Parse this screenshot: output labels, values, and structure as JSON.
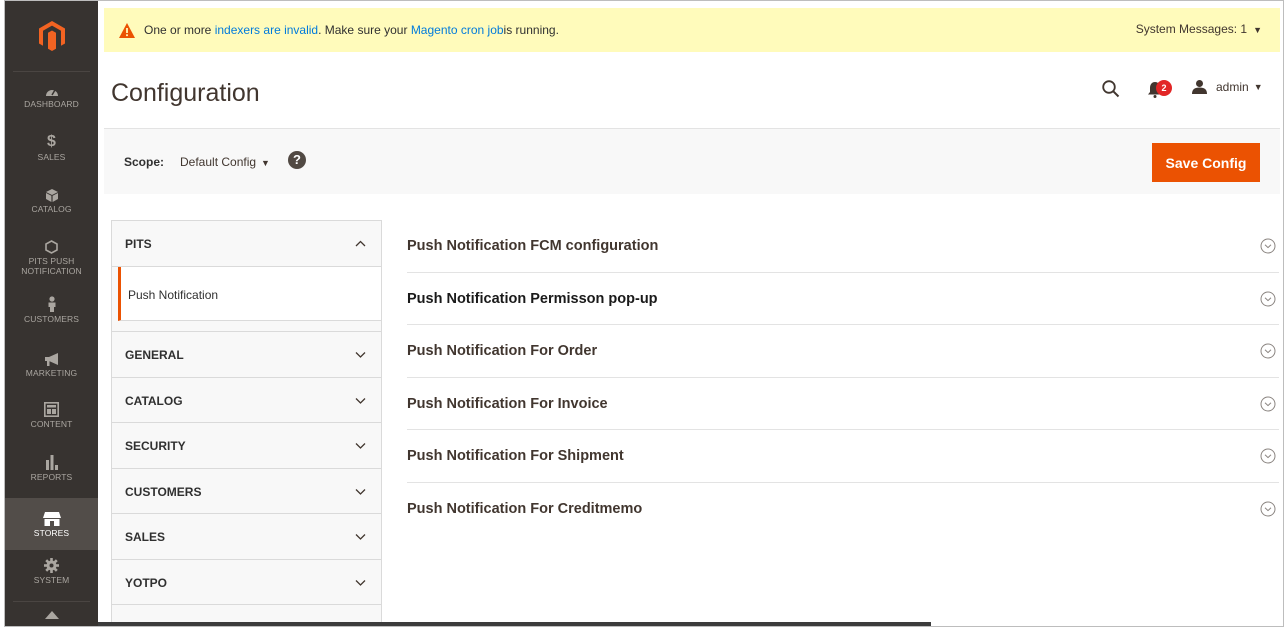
{
  "colors": {
    "sidebar_bg": "#373330",
    "accent": "#eb5202",
    "link": "#007bdb",
    "message_bg": "#fffbbb"
  },
  "sidebar": {
    "items": [
      {
        "label": "DASHBOARD",
        "icon": "dashboard-icon"
      },
      {
        "label": "SALES",
        "icon": "dollar-icon"
      },
      {
        "label": "CATALOG",
        "icon": "box-icon"
      },
      {
        "label": "PITS PUSH NOTIFICATION",
        "label_line1": "PITS PUSH",
        "label_line2": "NOTIFICATION",
        "icon": "hexagon-icon"
      },
      {
        "label": "CUSTOMERS",
        "icon": "person-icon"
      },
      {
        "label": "MARKETING",
        "icon": "megaphone-icon"
      },
      {
        "label": "CONTENT",
        "icon": "content-icon"
      },
      {
        "label": "REPORTS",
        "icon": "bar-chart-icon"
      },
      {
        "label": "STORES",
        "icon": "store-icon",
        "active": true
      },
      {
        "label": "SYSTEM",
        "icon": "gear-icon"
      }
    ]
  },
  "message_bar": {
    "prefix": "One or more ",
    "link1": "indexers are invalid",
    "middle": ". Make sure your ",
    "link2": "Magento cron job",
    "suffix": " is running.",
    "system_messages": "System Messages: 1"
  },
  "header": {
    "title": "Configuration",
    "notification_count": "2",
    "user": "admin"
  },
  "scope": {
    "label": "Scope:",
    "value": "Default Config",
    "help": "?",
    "save_label": "Save Config"
  },
  "tabs": {
    "pits": {
      "label": "PITS",
      "sub_item": "Push Notification"
    },
    "groups": [
      "GENERAL",
      "CATALOG",
      "SECURITY",
      "CUSTOMERS",
      "SALES",
      "YOTPO"
    ]
  },
  "sections": [
    "Push Notification FCM configuration",
    "Push Notification Permisson pop-up",
    "Push Notification For Order",
    "Push Notification For Invoice",
    "Push Notification For Shipment",
    "Push Notification For Creditmemo"
  ]
}
